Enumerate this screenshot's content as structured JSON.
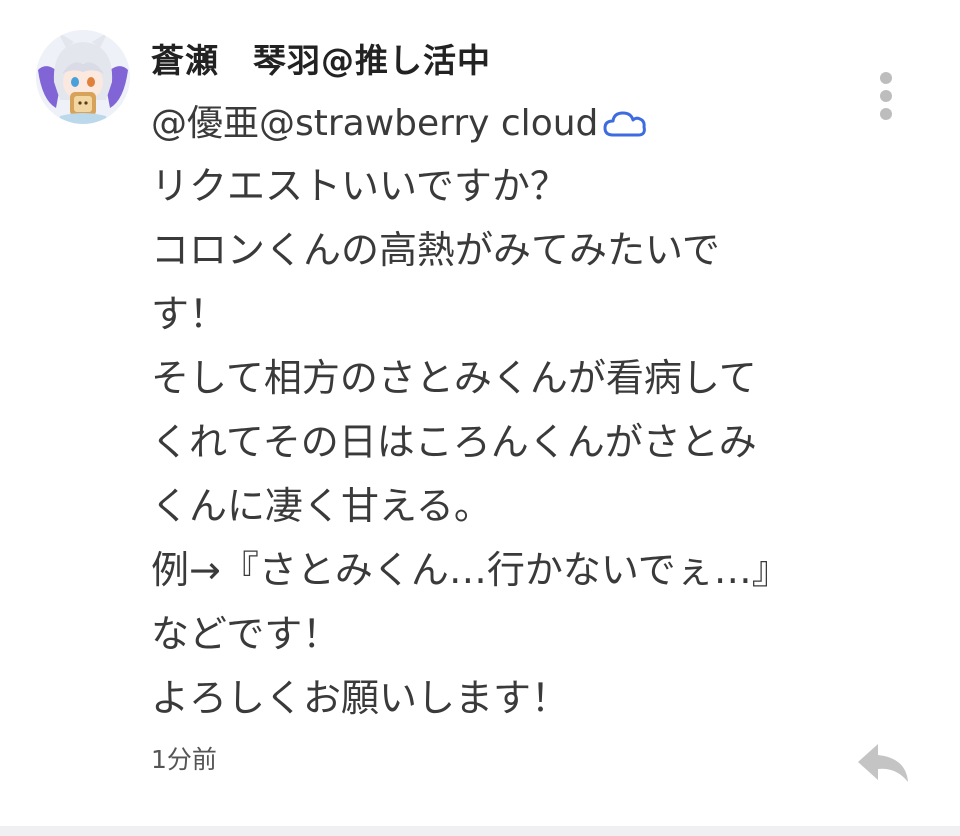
{
  "comment": {
    "username": "蒼瀬　琴羽@推し活中",
    "mention": "@優亜@strawberry cloud",
    "lines": [
      "リクエストいいですか？",
      "コロンくんの高熱がみてみたいで",
      "す！",
      "そして相方のさとみくんが看病して",
      "くれてその日はころんくんがさとみ",
      "くんに凄く甘える。",
      "例→『さとみくん…行かないでぇ…』",
      "などです！",
      "よろしくお願いします！"
    ],
    "timestamp": "1分前"
  },
  "icons": {
    "avatar": "avatar-image",
    "cloud": "cloud-icon",
    "more": "more-vertical-icon",
    "reply": "reply-arrow-icon"
  },
  "colors": {
    "text": "#3a3a3a",
    "username": "#222222",
    "cloud": "#3d6be0",
    "icon_gray": "#bdbdbd"
  }
}
